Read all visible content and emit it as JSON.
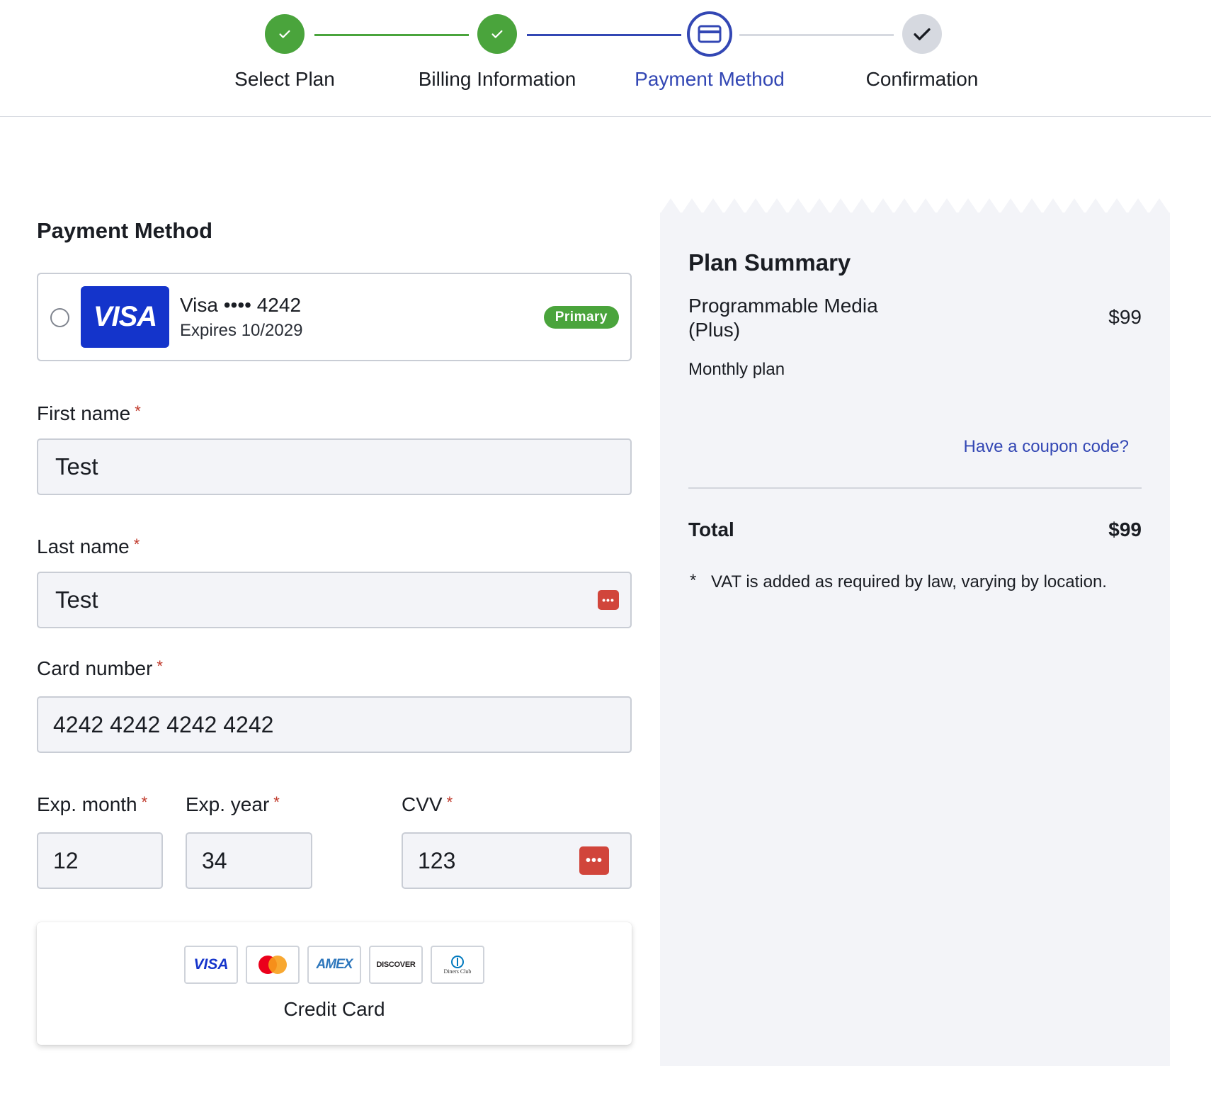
{
  "stepper": {
    "steps": [
      {
        "label": "Select Plan",
        "state": "done"
      },
      {
        "label": "Billing Information",
        "state": "done"
      },
      {
        "label": "Payment Method",
        "state": "active"
      },
      {
        "label": "Confirmation",
        "state": "pending"
      }
    ]
  },
  "payment": {
    "title": "Payment Method",
    "saved_card": {
      "brand": "VISA",
      "name": "Visa •••• 4242",
      "expires": "Expires 10/2029",
      "badge": "Primary",
      "selected": false
    },
    "fields": {
      "first_name": {
        "label": "First name",
        "value": "Test"
      },
      "last_name": {
        "label": "Last name",
        "value": "Test"
      },
      "card_number": {
        "label": "Card number",
        "value": "4242 4242 4242 4242"
      },
      "exp_month": {
        "label": "Exp. month",
        "value": "12"
      },
      "exp_year": {
        "label": "Exp. year",
        "value": "34"
      },
      "cvv": {
        "label": "CVV",
        "value": "123"
      }
    },
    "required_marker": "*",
    "method": {
      "label": "Credit Card",
      "brands": [
        {
          "name": "visa",
          "text": "VISA"
        },
        {
          "name": "mastercard",
          "text": ""
        },
        {
          "name": "amex",
          "text": "AMEX"
        },
        {
          "name": "discover",
          "text": "DISCOVER"
        },
        {
          "name": "diners",
          "text": "Diners Club"
        }
      ]
    }
  },
  "summary": {
    "title": "Plan Summary",
    "product": "Programmable Media (Plus)",
    "price": "$99",
    "plan_type": "Monthly plan",
    "coupon_link": "Have a coupon code?",
    "total_label": "Total",
    "total_value": "$99",
    "vat_marker": "*",
    "vat_note": "VAT is added as required by law, varying by location."
  },
  "colors": {
    "done": "#4aa43c",
    "active": "#3347b4",
    "pending": "#d6d9e0",
    "visa_blue": "#1434cb",
    "password_icon": "#d1453b",
    "summary_bg": "#f3f4f8"
  }
}
